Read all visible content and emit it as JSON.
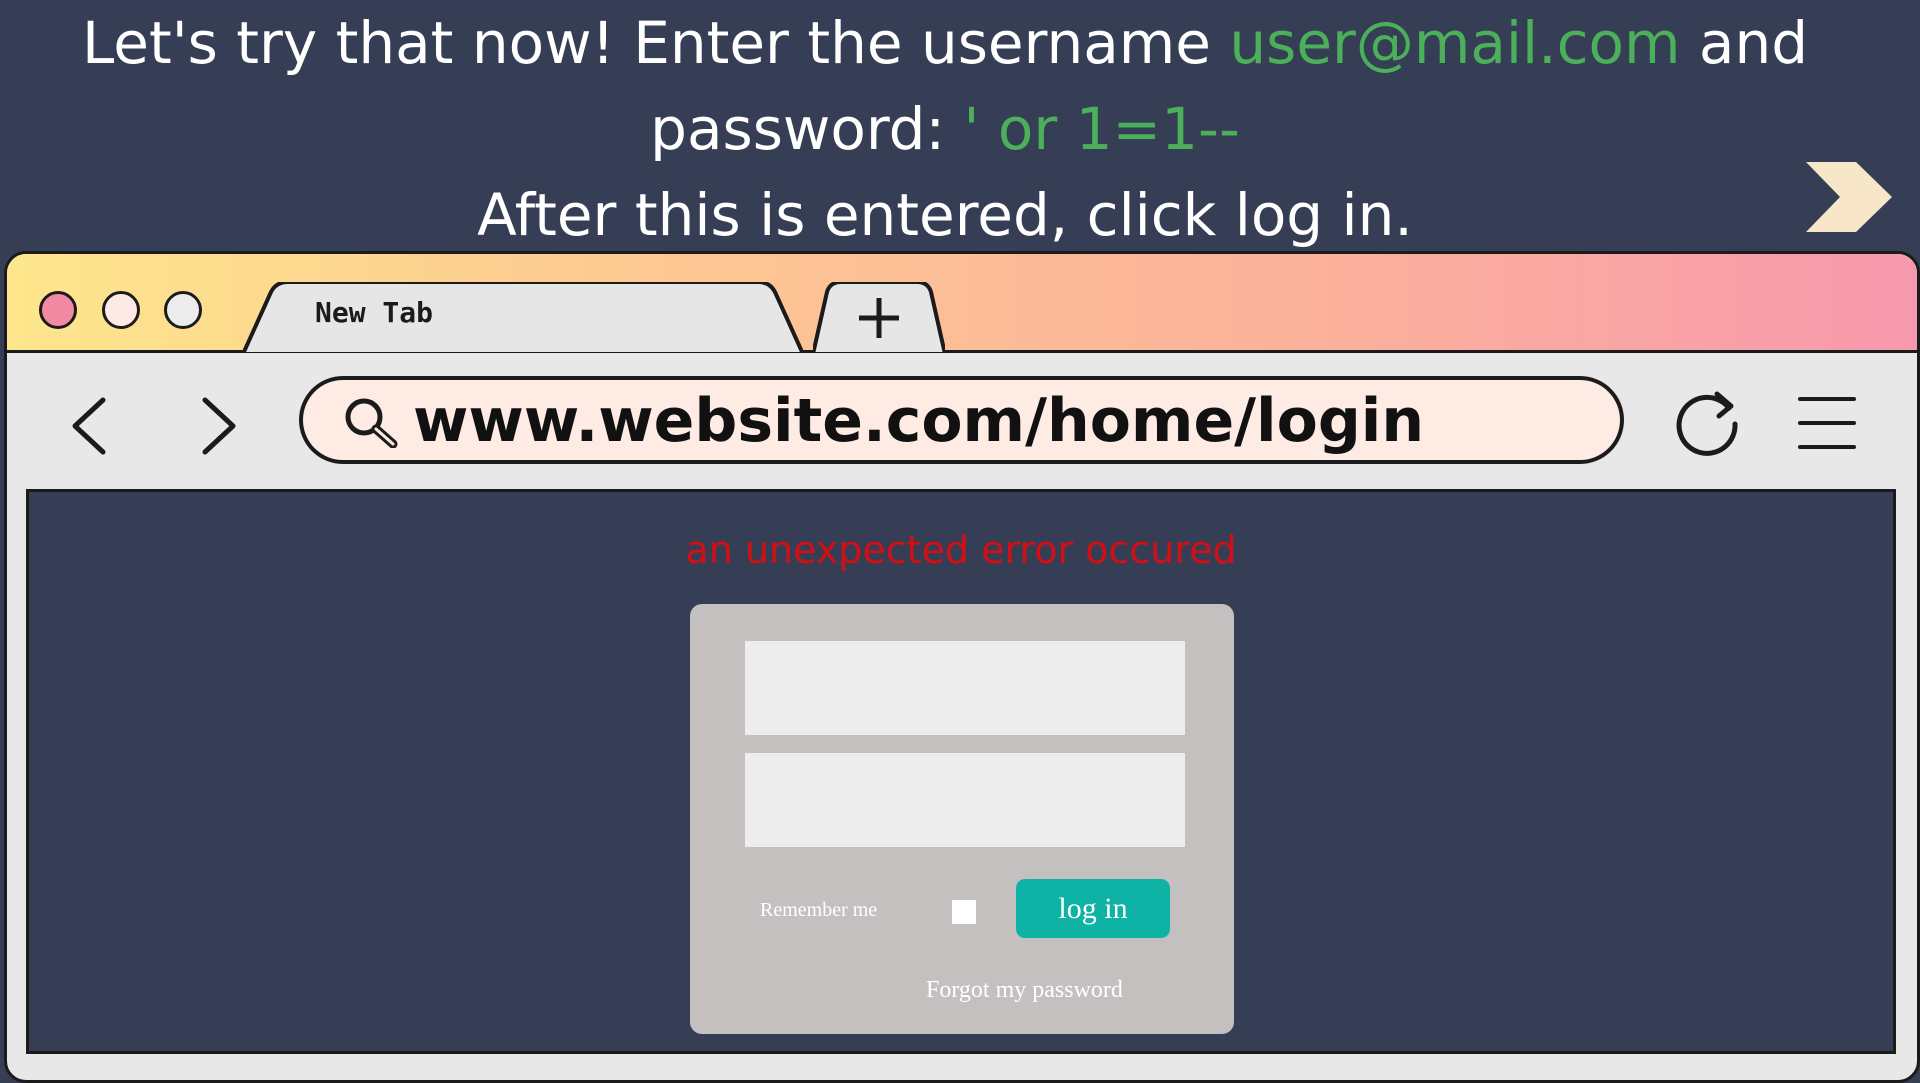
{
  "instructions": {
    "line1_a": "Let's try that now! Enter the username ",
    "username": "user@mail.com",
    "line1_b": " and",
    "line2_a": "password: ",
    "password": "' or 1=1--",
    "line3": "After this is entered, click log in."
  },
  "next_icon": "chevron-right-icon",
  "browser": {
    "window_controls": [
      "close-dot",
      "minimize-dot",
      "maximize-dot"
    ],
    "tab_label": "New Tab",
    "new_tab_icon": "plus-icon",
    "url": "www.website.com/home/login",
    "icons": [
      "back-arrow-icon",
      "forward-arrow-icon",
      "search-icon",
      "reload-icon",
      "hamburger-menu-icon"
    ]
  },
  "page": {
    "error_message": "an unexpected error occured",
    "login": {
      "username_value": "",
      "password_value": "",
      "remember_label": "Remember me",
      "remember_checked": false,
      "login_label": "log in",
      "forgot_label": "Forgot my password"
    }
  },
  "colors": {
    "background": "#353e55",
    "highlight_green": "#4caf5a",
    "error_red": "#d20f14",
    "login_button": "#0eb3a5",
    "card": "#c4c0bf",
    "address_bar": "#fdebe4",
    "gradient": [
      "#fde68c",
      "#fdc793",
      "#fbb09c",
      "#f799ae"
    ],
    "close_dot": "#f38aa3",
    "minimize_dot": "#fde9e6",
    "maximize_dot": "#ececec",
    "next_arrow": "#f8e6c8"
  }
}
